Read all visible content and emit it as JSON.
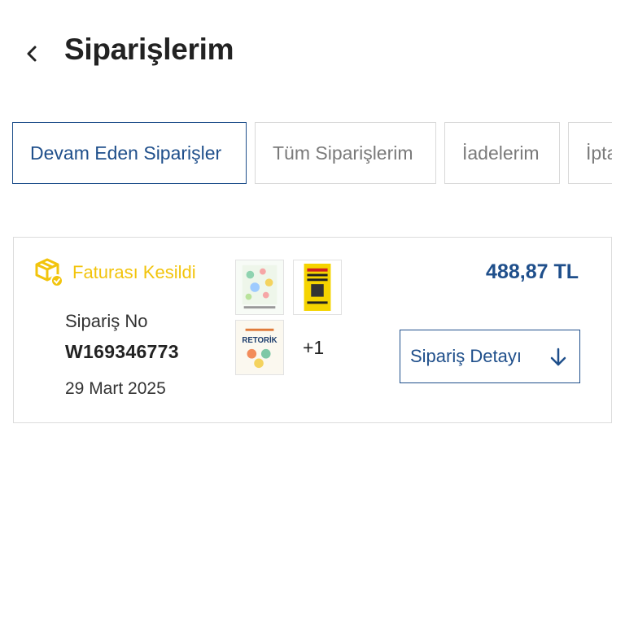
{
  "header": {
    "title": "Siparişlerim"
  },
  "tabs": [
    {
      "label": "Devam Eden Siparişler",
      "active": true
    },
    {
      "label": "Tüm Siparişlerim",
      "active": false
    },
    {
      "label": "İadelerim",
      "active": false
    },
    {
      "label": "İpta",
      "active": false
    }
  ],
  "order": {
    "status": "Faturası Kesildi",
    "order_no_label": "Sipariş No",
    "order_no": "W169346773",
    "date": "29 Mart 2025",
    "more_items": "+1",
    "price": "488,87 TL",
    "detail_button": "Sipariş Detayı",
    "thumbnails": [
      {
        "name": "book-cover-1",
        "text": ""
      },
      {
        "name": "book-cover-2",
        "text": ""
      },
      {
        "name": "book-cover-3",
        "text": "RETORİK"
      }
    ]
  },
  "colors": {
    "accent": "#1f4f8b",
    "status": "#f2c40c",
    "border": "#dcdcdc"
  },
  "icons": {
    "back": "chevron-left-icon",
    "status": "package-invoice-icon",
    "detail": "arrow-down-icon"
  }
}
